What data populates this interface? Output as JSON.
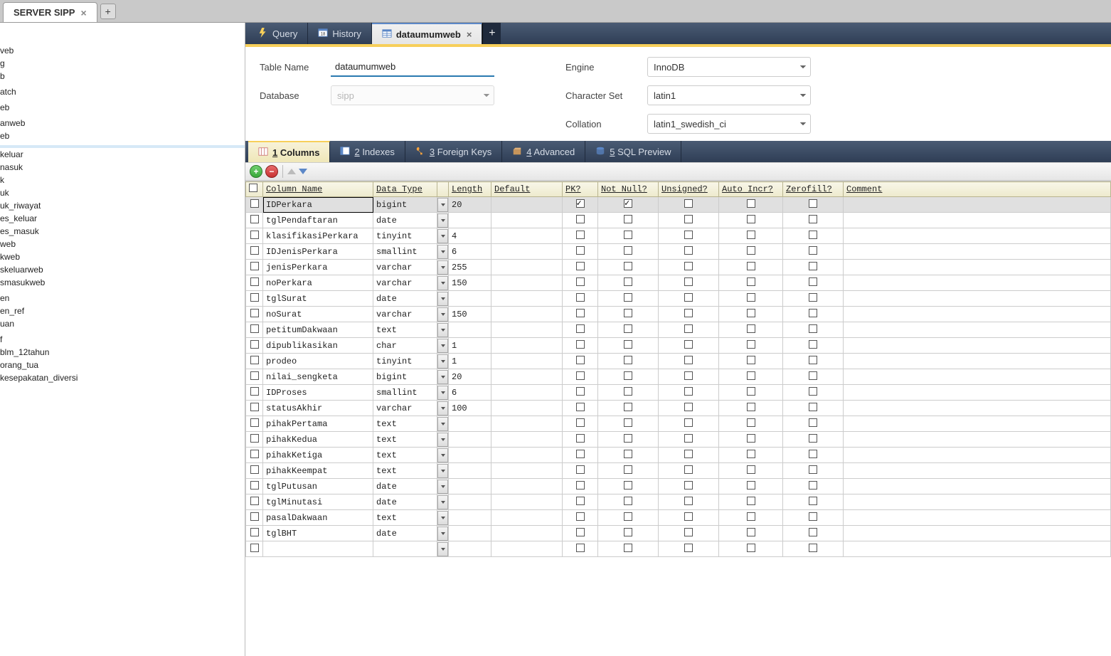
{
  "topTabs": {
    "active": "SERVER SIPP"
  },
  "sidebar": {
    "items": [
      "veb",
      "g",
      "b",
      "",
      "atch",
      "",
      "eb",
      "",
      "anweb",
      "eb",
      "",
      "",
      "keluar",
      "nasuk",
      "k",
      "uk",
      "uk_riwayat",
      "es_keluar",
      "es_masuk",
      "web",
      "kweb",
      "skeluarweb",
      "smasukweb",
      "",
      "en",
      "en_ref",
      "uan",
      "",
      "f",
      "blm_12tahun",
      "orang_tua",
      "kesepakatan_diversi"
    ],
    "activeIndex": 11
  },
  "editorTabs": {
    "items": [
      {
        "label": "Query",
        "icon": "bolt"
      },
      {
        "label": "History",
        "icon": "calendar"
      },
      {
        "label": "dataumumweb",
        "icon": "table",
        "closable": true
      }
    ],
    "activeIndex": 2
  },
  "form": {
    "tableNameLabel": "Table Name",
    "tableName": "dataumumweb",
    "databaseLabel": "Database",
    "database": "sipp",
    "engineLabel": "Engine",
    "engine": "InnoDB",
    "charsetLabel": "Character Set",
    "charset": "latin1",
    "collationLabel": "Collation",
    "collation": "latin1_swedish_ci"
  },
  "subtabs": {
    "items": [
      {
        "num": "1",
        "label": "Columns"
      },
      {
        "num": "2",
        "label": "Indexes"
      },
      {
        "num": "3",
        "label": "Foreign Keys"
      },
      {
        "num": "4",
        "label": "Advanced"
      },
      {
        "num": "5",
        "label": "SQL Preview"
      }
    ],
    "activeIndex": 0
  },
  "grid": {
    "headers": [
      "",
      "Column Name",
      "Data Type",
      "",
      "Length",
      "Default",
      "PK?",
      "Not Null?",
      "Unsigned?",
      "Auto Incr?",
      "Zerofill?",
      "Comment"
    ],
    "rows": [
      {
        "name": "IDPerkara",
        "type": "bigint",
        "len": "20",
        "def": "",
        "pk": true,
        "nn": true,
        "un": false,
        "ai": false,
        "zf": false,
        "cm": "",
        "selected": true
      },
      {
        "name": "tglPendaftaran",
        "type": "date",
        "len": "",
        "def": "",
        "pk": false,
        "nn": false,
        "un": false,
        "ai": false,
        "zf": false,
        "cm": ""
      },
      {
        "name": "klasifikasiPerkara",
        "type": "tinyint",
        "len": "4",
        "def": "",
        "pk": false,
        "nn": false,
        "un": false,
        "ai": false,
        "zf": false,
        "cm": ""
      },
      {
        "name": "IDJenisPerkara",
        "type": "smallint",
        "len": "6",
        "def": "",
        "pk": false,
        "nn": false,
        "un": false,
        "ai": false,
        "zf": false,
        "cm": ""
      },
      {
        "name": "jenisPerkara",
        "type": "varchar",
        "len": "255",
        "def": "",
        "pk": false,
        "nn": false,
        "un": false,
        "ai": false,
        "zf": false,
        "cm": ""
      },
      {
        "name": "noPerkara",
        "type": "varchar",
        "len": "150",
        "def": "",
        "pk": false,
        "nn": false,
        "un": false,
        "ai": false,
        "zf": false,
        "cm": ""
      },
      {
        "name": "tglSurat",
        "type": "date",
        "len": "",
        "def": "",
        "pk": false,
        "nn": false,
        "un": false,
        "ai": false,
        "zf": false,
        "cm": ""
      },
      {
        "name": "noSurat",
        "type": "varchar",
        "len": "150",
        "def": "",
        "pk": false,
        "nn": false,
        "un": false,
        "ai": false,
        "zf": false,
        "cm": ""
      },
      {
        "name": "petitumDakwaan",
        "type": "text",
        "len": "",
        "def": "",
        "pk": false,
        "nn": false,
        "un": false,
        "ai": false,
        "zf": false,
        "cm": ""
      },
      {
        "name": "dipublikasikan",
        "type": "char",
        "len": "1",
        "def": "",
        "pk": false,
        "nn": false,
        "un": false,
        "ai": false,
        "zf": false,
        "cm": ""
      },
      {
        "name": "prodeo",
        "type": "tinyint",
        "len": "1",
        "def": "",
        "pk": false,
        "nn": false,
        "un": false,
        "ai": false,
        "zf": false,
        "cm": ""
      },
      {
        "name": "nilai_sengketa",
        "type": "bigint",
        "len": "20",
        "def": "",
        "pk": false,
        "nn": false,
        "un": false,
        "ai": false,
        "zf": false,
        "cm": ""
      },
      {
        "name": "IDProses",
        "type": "smallint",
        "len": "6",
        "def": "",
        "pk": false,
        "nn": false,
        "un": false,
        "ai": false,
        "zf": false,
        "cm": ""
      },
      {
        "name": "statusAkhir",
        "type": "varchar",
        "len": "100",
        "def": "",
        "pk": false,
        "nn": false,
        "un": false,
        "ai": false,
        "zf": false,
        "cm": ""
      },
      {
        "name": "pihakPertama",
        "type": "text",
        "len": "",
        "def": "",
        "pk": false,
        "nn": false,
        "un": false,
        "ai": false,
        "zf": false,
        "cm": ""
      },
      {
        "name": "pihakKedua",
        "type": "text",
        "len": "",
        "def": "",
        "pk": false,
        "nn": false,
        "un": false,
        "ai": false,
        "zf": false,
        "cm": ""
      },
      {
        "name": "pihakKetiga",
        "type": "text",
        "len": "",
        "def": "",
        "pk": false,
        "nn": false,
        "un": false,
        "ai": false,
        "zf": false,
        "cm": ""
      },
      {
        "name": "pihakKeempat",
        "type": "text",
        "len": "",
        "def": "",
        "pk": false,
        "nn": false,
        "un": false,
        "ai": false,
        "zf": false,
        "cm": ""
      },
      {
        "name": "tglPutusan",
        "type": "date",
        "len": "",
        "def": "",
        "pk": false,
        "nn": false,
        "un": false,
        "ai": false,
        "zf": false,
        "cm": ""
      },
      {
        "name": "tglMinutasi",
        "type": "date",
        "len": "",
        "def": "",
        "pk": false,
        "nn": false,
        "un": false,
        "ai": false,
        "zf": false,
        "cm": ""
      },
      {
        "name": "pasalDakwaan",
        "type": "text",
        "len": "",
        "def": "",
        "pk": false,
        "nn": false,
        "un": false,
        "ai": false,
        "zf": false,
        "cm": ""
      },
      {
        "name": "tglBHT",
        "type": "date",
        "len": "",
        "def": "",
        "pk": false,
        "nn": false,
        "un": false,
        "ai": false,
        "zf": false,
        "cm": ""
      },
      {
        "name": "",
        "type": "",
        "len": "",
        "def": "",
        "pk": false,
        "nn": false,
        "un": false,
        "ai": false,
        "zf": false,
        "cm": ""
      }
    ]
  }
}
